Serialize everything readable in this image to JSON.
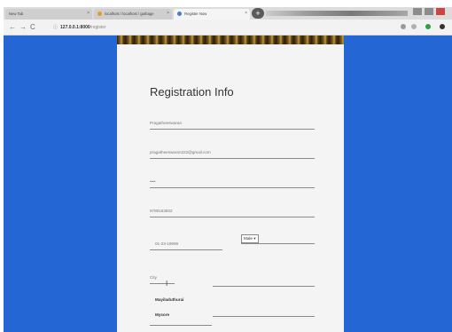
{
  "browser": {
    "tabs": [
      {
        "label": "New Tab"
      },
      {
        "label": "localhost / localhost / garbage"
      },
      {
        "label": "Register Now"
      }
    ],
    "new_tab_symbol": "+",
    "url": {
      "host": "127.0.0.1:8000",
      "path": "/register"
    }
  },
  "form": {
    "title": "Registration Info",
    "fields": {
      "name": "Pragatheeswaran",
      "email": "pragatheeswaran222@gmail.com",
      "password": "••••",
      "phone": "9789163602",
      "dob": "01-23-19999",
      "gender": "Male ▾",
      "city": "City",
      "address": "Mayiladuthurai",
      "district": "Mysore"
    }
  },
  "colors": {
    "page_bg": "#2466d4",
    "card_bg": "#f4f4f4"
  }
}
